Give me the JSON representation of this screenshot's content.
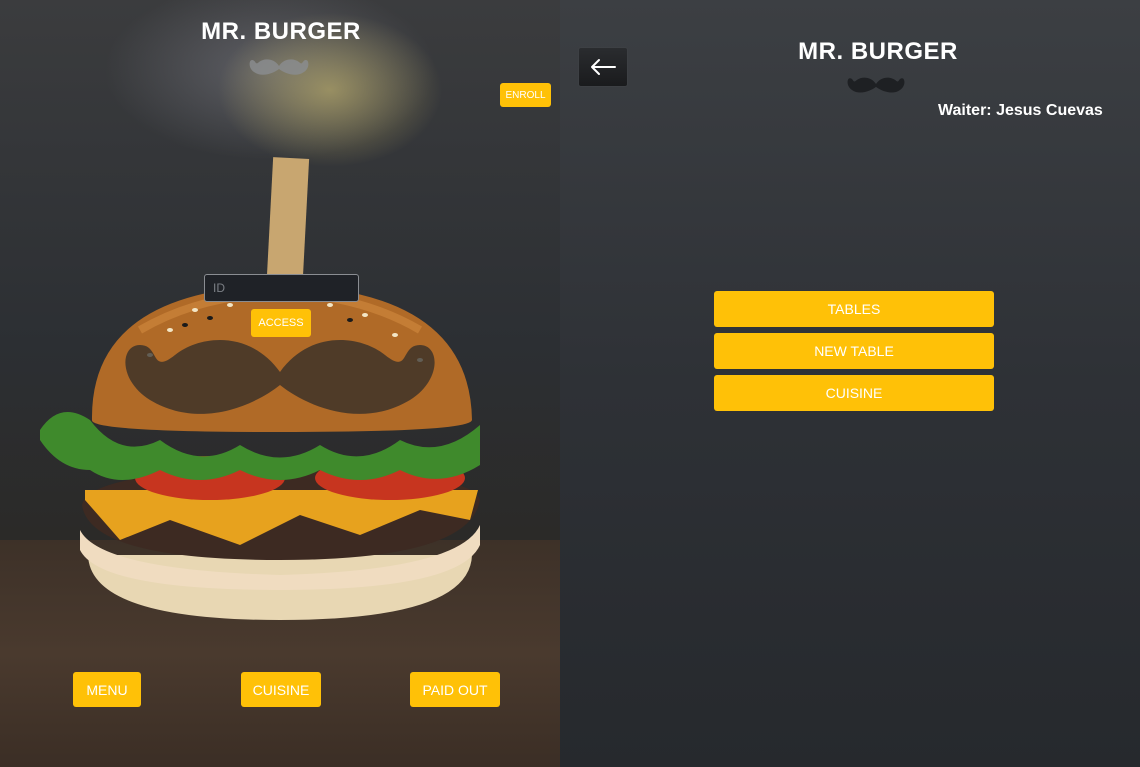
{
  "left": {
    "title": "MR. BURGER",
    "enroll_label": "ENROLL",
    "id_placeholder": "ID",
    "access_label": "ACCESS",
    "bottom_buttons": {
      "menu": "MENU",
      "cuisine": "CUISINE",
      "paid_out": "PAID OUT"
    },
    "background_image": "burger-photo",
    "logo_icon": "mustache-icon"
  },
  "right": {
    "back_icon": "arrow-left-icon",
    "title": "MR. BURGER",
    "logo_icon": "mustache-icon",
    "waiter": "Waiter: Jesus Cuevas",
    "buttons": {
      "tables": "TABLES",
      "new_table": "NEW TABLE",
      "cuisine": "CUISINE"
    }
  },
  "colors": {
    "accent": "#ffc107",
    "panel_dark": "#2e3136",
    "text": "#ffffff"
  }
}
